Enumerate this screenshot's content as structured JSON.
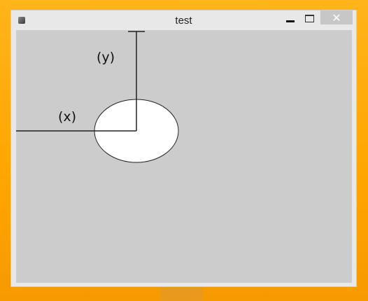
{
  "window": {
    "title": "test",
    "icons": {
      "app": "app-icon",
      "minimize": "minimize-icon",
      "maximize": "maximize-icon",
      "close": "close-icon"
    },
    "close_glyph": "✕"
  },
  "canvas": {
    "background": "#cccccc",
    "ellipse_fill": "#ffffff",
    "line_color": "#222222",
    "labels": {
      "x": "(x)",
      "y": "(y)"
    }
  }
}
